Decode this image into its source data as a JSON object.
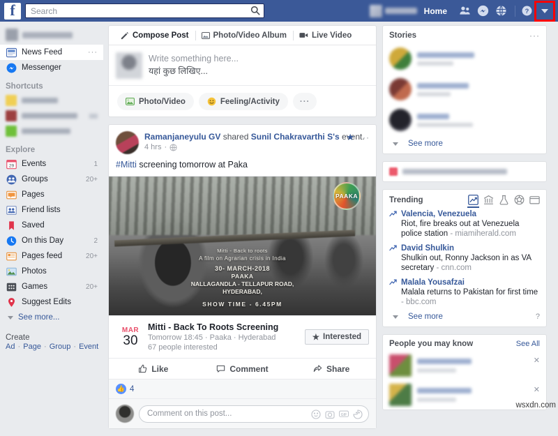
{
  "topbar": {
    "logo": "f",
    "search_placeholder": "Search",
    "search_value": "",
    "search_icon": "search-icon",
    "home_label": "Home",
    "icons": [
      "friend-requests-icon",
      "messenger-icon",
      "notifications-globe-icon",
      "help-icon",
      "account-dropdown-caret-icon"
    ]
  },
  "sidebar": {
    "primary": [
      {
        "label": "News Feed",
        "icon": "news-feed-icon",
        "count": "",
        "active": true,
        "dots": "···"
      },
      {
        "label": "Messenger",
        "icon": "messenger-icon",
        "count": "",
        "active": false,
        "dots": ""
      }
    ],
    "shortcuts_heading": "Shortcuts",
    "shortcuts_blurred_count": 3,
    "explore_heading": "Explore",
    "explore": [
      {
        "label": "Events",
        "icon": "calendar-icon",
        "count": "1"
      },
      {
        "label": "Groups",
        "icon": "groups-icon",
        "count": "20+"
      },
      {
        "label": "Pages",
        "icon": "pages-flag-icon",
        "count": ""
      },
      {
        "label": "Friend lists",
        "icon": "friend-lists-icon",
        "count": ""
      },
      {
        "label": "Saved",
        "icon": "bookmark-icon",
        "count": ""
      },
      {
        "label": "On this Day",
        "icon": "clock-history-icon",
        "count": "2"
      },
      {
        "label": "Pages feed",
        "icon": "pages-feed-icon",
        "count": "20+"
      },
      {
        "label": "Photos",
        "icon": "photos-icon",
        "count": ""
      },
      {
        "label": "Games",
        "icon": "games-icon",
        "count": "20+"
      },
      {
        "label": "Suggest Edits",
        "icon": "map-pin-icon",
        "count": ""
      }
    ],
    "see_more_label": "See more...",
    "create_heading": "Create",
    "create_links": [
      "Ad",
      "Page",
      "Group",
      "Event"
    ]
  },
  "composer": {
    "tabs": [
      {
        "label": "Compose Post",
        "icon": "pencil-icon",
        "selected": true
      },
      {
        "label": "Photo/Video Album",
        "icon": "album-icon",
        "selected": false
      },
      {
        "label": "Live Video",
        "icon": "live-video-icon",
        "selected": false
      }
    ],
    "placeholder_en": "Write something here...",
    "placeholder_hi": "यहां कुछ लिखिए...",
    "actions": [
      {
        "label": "Photo/Video",
        "icon": "photo-video-icon"
      },
      {
        "label": "Feeling/Activity",
        "icon": "feeling-smiley-icon"
      },
      {
        "label": "···",
        "icon": "more-options-icon"
      }
    ]
  },
  "post": {
    "author": "Ramanjaneyulu GV",
    "action_text": " shared ",
    "event_owner": "Sunil Chakravarthi S's",
    "action_tail": " event.",
    "timestamp": "4 hrs",
    "privacy_icon": "globe-icon",
    "star_icon": "star-icon",
    "menu_icon": "more-dots-icon",
    "body_hashtag": "#Mitti",
    "body_text": " screening tomorrow at Paka",
    "image": {
      "badge_text": "PAAKA",
      "caption_line1": "Mitti - Back to roots",
      "caption_line2": "A film on Agrarian crisis in India",
      "caption_line3": "30- MARCH-2018",
      "caption_line4": "PAAKA",
      "caption_line5": "NALLAGANDLA - TELLAPUR ROAD,",
      "caption_line6": "HYDERABAD,",
      "caption_line7": "SHOW TIME - 6.45PM"
    },
    "event": {
      "month": "MAR",
      "day": "30",
      "title": "Mitti - Back To Roots Screening",
      "subtitle": "Tomorrow 18:45 · Paaka · Hyderabad",
      "interested_count": "67 people interested",
      "button_label": "Interested",
      "button_icon": "star-icon"
    },
    "actions": [
      {
        "label": "Like",
        "icon": "thumbs-up-icon"
      },
      {
        "label": "Comment",
        "icon": "comment-bubble-icon"
      },
      {
        "label": "Share",
        "icon": "share-arrow-icon"
      }
    ],
    "like_count": "4",
    "comment_placeholder": "Comment on this post...",
    "comment_icons": [
      "emoji-icon",
      "camera-icon",
      "gif-icon",
      "sticker-icon"
    ]
  },
  "stories": {
    "title": "Stories",
    "menu_icon": "more-dots-icon",
    "items": [
      {
        "avatar_colors": "#cfa93a,#3f7f3b",
        "name_color": "#9fb0d0"
      },
      {
        "avatar_colors": "#7a3a34,#c06a4e",
        "name_color": "#9fb0d0"
      },
      {
        "avatar_colors": "#1a1a22,#3b3b47",
        "name_color": "#9fb0d0"
      }
    ],
    "see_more_label": "See more"
  },
  "trending": {
    "title": "Trending",
    "filter_icons": [
      "trending-chart-icon",
      "politics-bank-icon",
      "science-flask-icon",
      "sports-ball-icon",
      "entertainment-tv-icon"
    ],
    "items": [
      {
        "topic": "Valencia, Venezuela",
        "desc": "Riot, fire breaks out at Venezuela police station",
        "source": " - miamiherald.com"
      },
      {
        "topic": "David Shulkin",
        "desc": "Shulkin out, Ronny Jackson in as VA secretary",
        "source": " - cnn.com"
      },
      {
        "topic": "Malala Yousafzai",
        "desc": "Malala returns to Pakistan for first time",
        "source": " - bbc.com"
      }
    ],
    "see_more_label": "See more",
    "help_label": "?"
  },
  "pymk": {
    "title": "People you may know",
    "see_all_label": "See All",
    "rows": 2,
    "close_icon": "close-x-icon"
  },
  "watermark": "wsxdn.com",
  "colors": {
    "brand_blue": "#3b5998",
    "link_blue": "#365899",
    "page_bg": "#e9ebee",
    "highlight_red": "#ff0000",
    "event_red": "#e9506b"
  }
}
